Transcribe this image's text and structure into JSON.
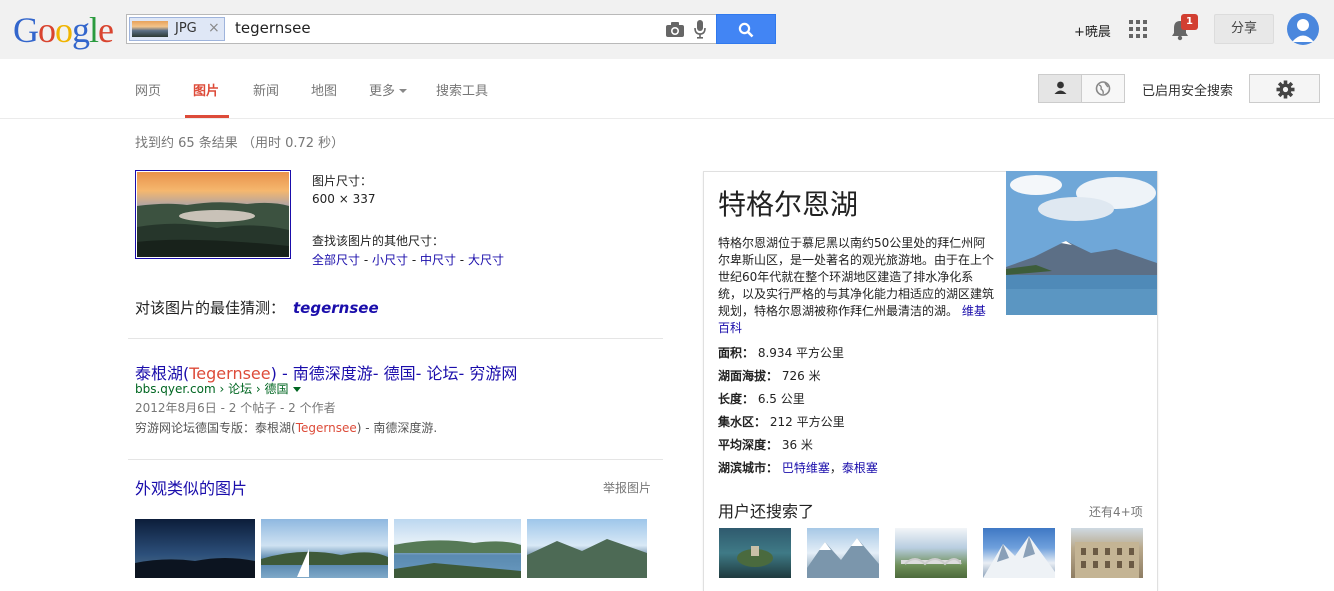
{
  "header": {
    "logo": "Google",
    "search": {
      "image_chip_label": "JPG",
      "query": "tegernsee"
    },
    "user_name": "+暁晨",
    "notification_count": "1",
    "share_label": "分享"
  },
  "nav": {
    "tabs": [
      "网页",
      "图片",
      "新闻",
      "地图",
      "更多",
      "搜索工具"
    ],
    "active_tab": "图片",
    "safe_search_label": "已启用安全搜索"
  },
  "results": {
    "stats": "找到约 65 条结果 （用时 0.72 秒）",
    "image_size_label": "图片尺寸：",
    "image_size_value": "600 × 337",
    "other_sizes_label": "查找该图片的其他尺寸：",
    "size_links": [
      "全部尺寸",
      "小尺寸",
      "中尺寸",
      "大尺寸"
    ],
    "best_guess_label": "对该图片的最佳猜测：",
    "best_guess_value": "tegernsee",
    "first_result": {
      "title_prefix": "泰根湖(",
      "title_em": "Tegernsee",
      "title_suffix": ") - 南德深度游- 德国- 论坛- 穷游网",
      "url": "bbs.qyer.com › 论坛 › 德国",
      "meta": "2012年8月6日 - 2 个帖子 - 2 个作者",
      "snippet_prefix": "穷游网论坛德国专版：泰根湖(",
      "snippet_em": "Tegernsee",
      "snippet_suffix": ") - 南德深度游."
    },
    "similar_title": "外观类似的图片",
    "report_label": "举报图片"
  },
  "knowledge_panel": {
    "title": "特格尔恩湖",
    "description": "特格尔恩湖位于慕尼黑以南约50公里处的拜仁州阿尔卑斯山区，是一处著名的观光旅游地。由于在上个世纪60年代就在整个环湖地区建造了排水净化系统，以及实行严格的与其净化能力相适应的湖区建筑规划，特格尔恩湖被称作拜仁州最清洁的湖。",
    "source_link": "维基百科",
    "facts": [
      {
        "label": "面积：",
        "value": "8.934 平方公里"
      },
      {
        "label": "湖面海拔：",
        "value": "726 米"
      },
      {
        "label": "长度：",
        "value": "6.5 公里"
      },
      {
        "label": "集水区：",
        "value": "212 平方公里"
      },
      {
        "label": "平均深度：",
        "value": "36 米"
      }
    ],
    "towns_label": "湖滨城市：",
    "towns": [
      "巴特维塞",
      "泰根塞"
    ],
    "also_searched_title": "用户还搜索了",
    "also_searched_more": "还有4+项"
  },
  "colors": {
    "link": "#1a0dab",
    "accent_red": "#dd4b39",
    "url_green": "#006621",
    "search_blue": "#4285f4"
  }
}
